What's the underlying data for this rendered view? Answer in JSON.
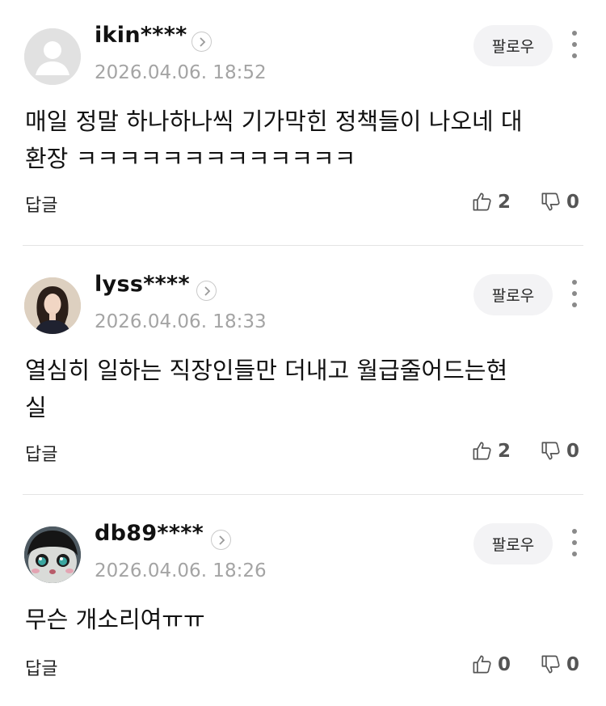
{
  "follow_label": "팔로우",
  "reply_label": "답글",
  "comments": [
    {
      "username": "ikin****",
      "timestamp": "2026.04.06. 18:52",
      "body_lines": [
        "매일 정말 하나하나씩 기가막힌 정책들이 나오네 대",
        "환장 ㅋㅋㅋㅋㅋㅋㅋㅋㅋㅋㅋㅋㅋ"
      ],
      "likes": "2",
      "dislikes": "0",
      "avatar": "default-avatar-icon"
    },
    {
      "username": "lyss****",
      "timestamp": "2026.04.06. 18:33",
      "body_lines": [
        "열심히 일하는 직장인들만 더내고 월급줄어드는현",
        "실"
      ],
      "likes": "2",
      "dislikes": "0",
      "avatar": "profile-photo"
    },
    {
      "username": "db89****",
      "timestamp": "2026.04.06. 18:26",
      "body_lines": [
        "무슨 개소리여ㅠㅠ"
      ],
      "likes": "0",
      "dislikes": "0",
      "avatar": "cartoon-face-avatar"
    }
  ]
}
